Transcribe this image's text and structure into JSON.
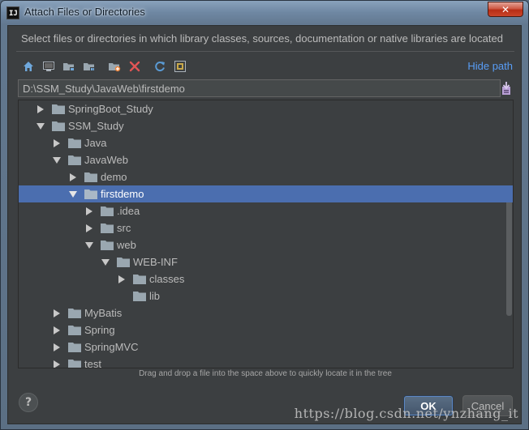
{
  "window": {
    "title": "Attach Files or Directories",
    "close_label": "✕"
  },
  "description": "Select files or directories in which library classes, sources, documentation or native libraries are located",
  "toolbar": {
    "hide_path_label": "Hide path",
    "icons": [
      "home-icon",
      "desktop-icon",
      "project-folder-icon",
      "module-folder-icon",
      "new-folder-icon",
      "delete-icon",
      "refresh-icon",
      "show-hidden-icon"
    ]
  },
  "path": {
    "value": "D:\\SSM_Study\\JavaWeb\\firstdemo"
  },
  "tree": {
    "items": [
      {
        "label": "SpringBoot_Study",
        "level": 1,
        "state": "collapsed",
        "selected": false
      },
      {
        "label": "SSM_Study",
        "level": 1,
        "state": "expanded",
        "selected": false
      },
      {
        "label": "Java",
        "level": 2,
        "state": "collapsed",
        "selected": false
      },
      {
        "label": "JavaWeb",
        "level": 2,
        "state": "expanded",
        "selected": false
      },
      {
        "label": "demo",
        "level": 3,
        "state": "collapsed",
        "selected": false
      },
      {
        "label": "firstdemo",
        "level": 3,
        "state": "expanded",
        "selected": true
      },
      {
        "label": ".idea",
        "level": 4,
        "state": "collapsed",
        "selected": false
      },
      {
        "label": "src",
        "level": 4,
        "state": "collapsed",
        "selected": false
      },
      {
        "label": "web",
        "level": 4,
        "state": "expanded",
        "selected": false
      },
      {
        "label": "WEB-INF",
        "level": 5,
        "state": "expanded",
        "selected": false
      },
      {
        "label": "classes",
        "level": 6,
        "state": "collapsed",
        "selected": false
      },
      {
        "label": "lib",
        "level": 6,
        "state": "leaf",
        "selected": false
      },
      {
        "label": "MyBatis",
        "level": 2,
        "state": "collapsed",
        "selected": false
      },
      {
        "label": "Spring",
        "level": 2,
        "state": "collapsed",
        "selected": false
      },
      {
        "label": "SpringMVC",
        "level": 2,
        "state": "collapsed",
        "selected": false
      },
      {
        "label": "test",
        "level": 2,
        "state": "collapsed",
        "selected": false
      }
    ]
  },
  "hint": "Drag and drop a file into the space above to quickly locate it in the tree",
  "buttons": {
    "help_label": "?",
    "ok_label": "OK",
    "cancel_label": "Cancel"
  },
  "watermark": "https://blog.csdn.net/ynzhang_it",
  "colors": {
    "selection": "#4b6eaf",
    "link": "#589df6",
    "folder": "#9aa7b0"
  }
}
